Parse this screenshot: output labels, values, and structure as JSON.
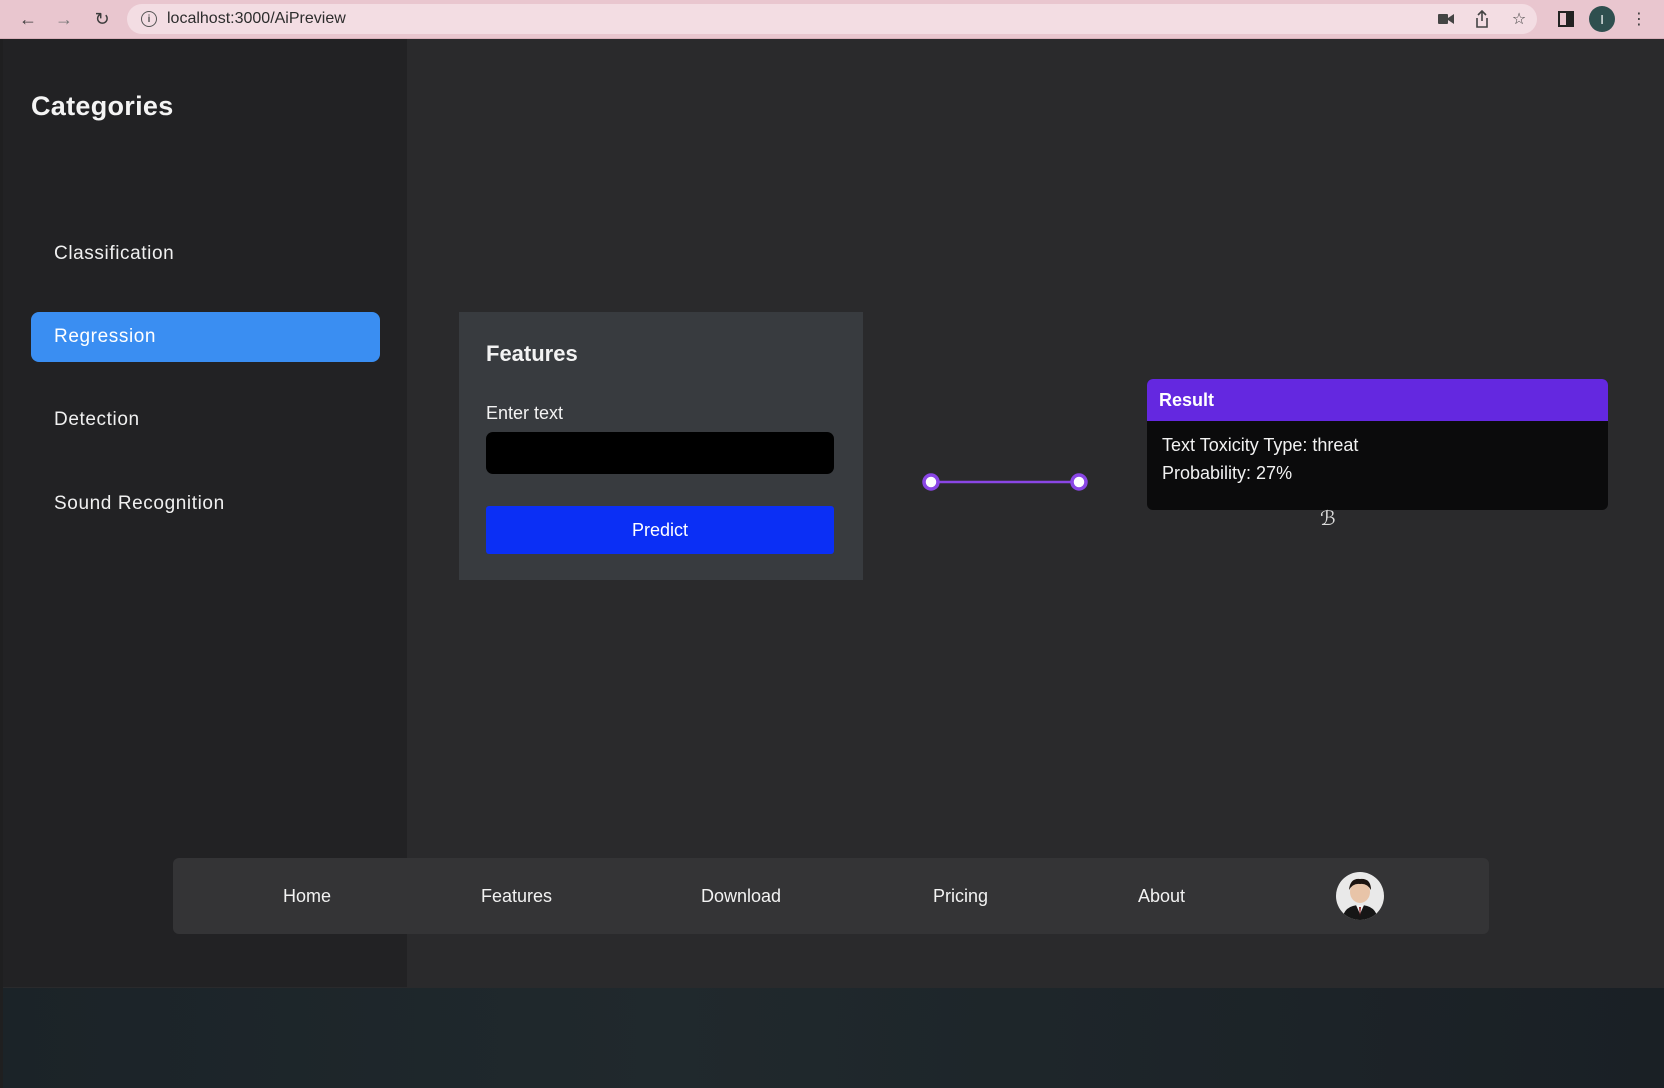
{
  "browser": {
    "url": "localhost:3000/AiPreview",
    "profile_initial": "I"
  },
  "sidebar": {
    "title": "Categories",
    "items": [
      {
        "label": "Classification",
        "active": false
      },
      {
        "label": "Regression",
        "active": true
      },
      {
        "label": "Detection",
        "active": false
      },
      {
        "label": "Sound Recognition",
        "active": false
      }
    ]
  },
  "features": {
    "title": "Features",
    "input_label": "Enter text",
    "input_value": "",
    "predict_label": "Predict"
  },
  "result": {
    "title": "Result",
    "toxicity_line": "Text Toxicity Type: threat",
    "probability_line": "Probability: 27%"
  },
  "bottom_nav": {
    "links": [
      "Home",
      "Features",
      "Download",
      "Pricing",
      "About"
    ]
  },
  "colors": {
    "accent_blue": "#3a8ef2",
    "predict_blue": "#0b2ff5",
    "result_purple": "#6428e0"
  }
}
